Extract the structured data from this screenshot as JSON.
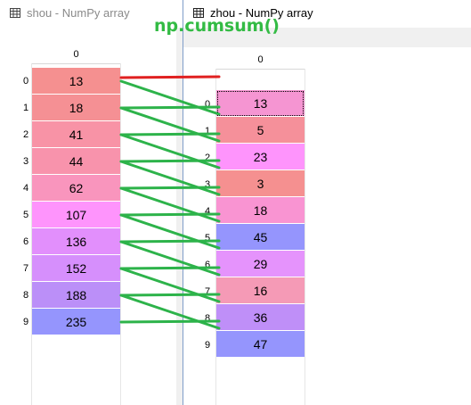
{
  "left_window": {
    "title": "shou - NumPy array",
    "column_header": "0",
    "rows": [
      {
        "index": "0",
        "value": "13",
        "color": "#f59090"
      },
      {
        "index": "1",
        "value": "18",
        "color": "#f59094"
      },
      {
        "index": "2",
        "value": "41",
        "color": "#f893a6"
      },
      {
        "index": "3",
        "value": "44",
        "color": "#f893ac"
      },
      {
        "index": "4",
        "value": "62",
        "color": "#f995bd"
      },
      {
        "index": "5",
        "value": "107",
        "color": "#fe94fc"
      },
      {
        "index": "6",
        "value": "136",
        "color": "#e28ffc"
      },
      {
        "index": "7",
        "value": "152",
        "color": "#d68ffc"
      },
      {
        "index": "8",
        "value": "188",
        "color": "#bb8ff8"
      },
      {
        "index": "9",
        "value": "235",
        "color": "#9595fd"
      }
    ]
  },
  "right_window": {
    "title": "zhou - NumPy array",
    "column_header": "0",
    "rows": [
      {
        "index": "0",
        "value": "13",
        "color": "#f595d2"
      },
      {
        "index": "1",
        "value": "5",
        "color": "#f5909a"
      },
      {
        "index": "2",
        "value": "23",
        "color": "#fe94fc"
      },
      {
        "index": "3",
        "value": "3",
        "color": "#f59090"
      },
      {
        "index": "4",
        "value": "18",
        "color": "#f994d2"
      },
      {
        "index": "5",
        "value": "45",
        "color": "#9595fd"
      },
      {
        "index": "6",
        "value": "29",
        "color": "#e593fc"
      },
      {
        "index": "7",
        "value": "16",
        "color": "#f59ab6"
      },
      {
        "index": "8",
        "value": "36",
        "color": "#bf8ff8"
      },
      {
        "index": "9",
        "value": "47",
        "color": "#9595fd"
      }
    ]
  },
  "annotation": {
    "label": "np.cumsum()",
    "color": "#33bb44",
    "arrow_green": "#2db34a",
    "arrow_red": "#e02020"
  },
  "icons": {
    "table": "table-grid-icon"
  }
}
